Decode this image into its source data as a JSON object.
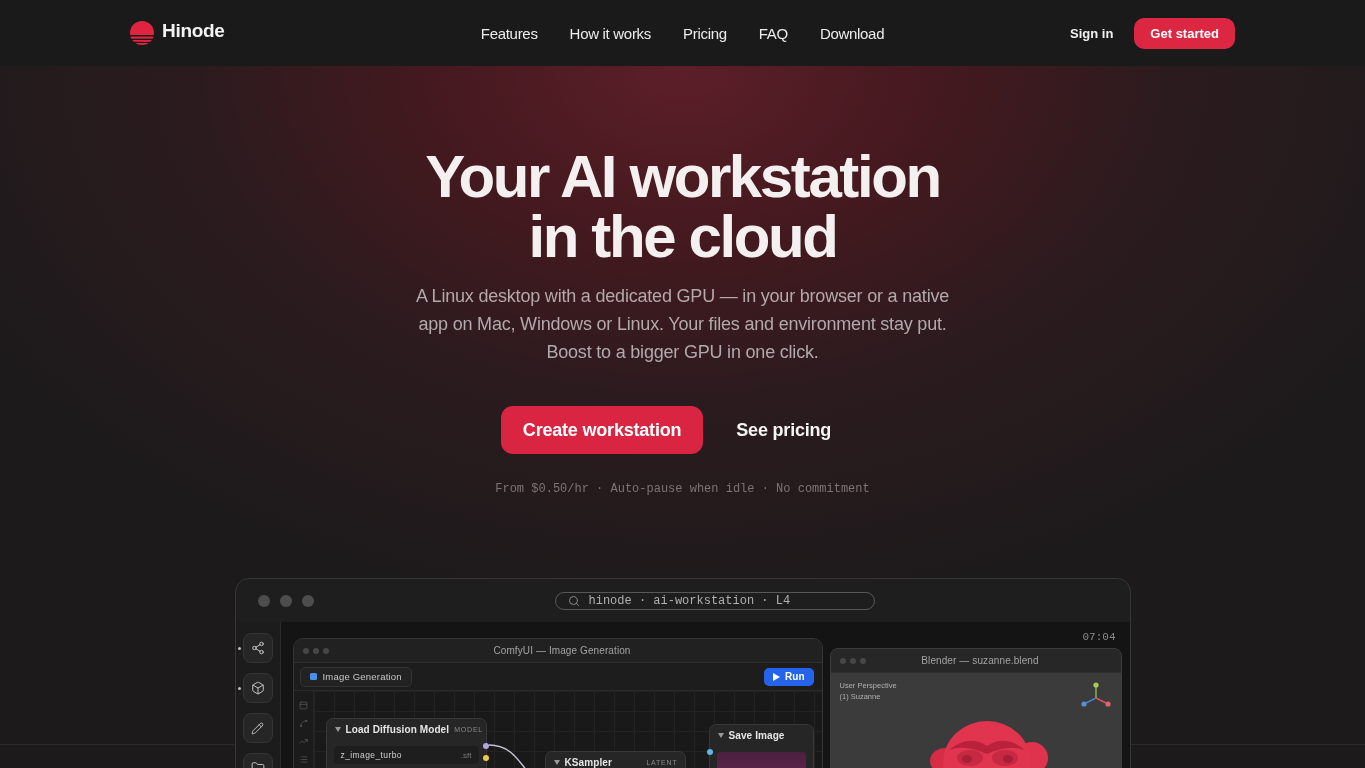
{
  "nav": {
    "brand": "Hinode",
    "links": [
      {
        "label": "Features"
      },
      {
        "label": "How it works"
      },
      {
        "label": "Pricing"
      },
      {
        "label": "FAQ"
      },
      {
        "label": "Download"
      }
    ],
    "sign_in": "Sign in",
    "cta": "Get started"
  },
  "hero": {
    "title_lines": [
      "Your AI workstation",
      "in the cloud"
    ],
    "subtitle_lines": [
      "A Linux desktop with a dedicated GPU — in your browser or a native",
      "app on Mac, Windows or Linux. Your files and environment stay put.",
      "Boost to a bigger GPU in one click."
    ],
    "primary_button": "Create workstation",
    "secondary_button": "See pricing",
    "note": "From $0.50/hr · Auto-pause when idle · No commitment"
  },
  "preview": {
    "address": "hinode · ai-workstation · L4",
    "clock": "07:04",
    "dock": [
      {
        "kind": "nodes",
        "running": true
      },
      {
        "kind": "cube",
        "running": true
      },
      {
        "kind": "pencil",
        "running": false
      },
      {
        "kind": "folder",
        "running": false
      }
    ],
    "comfy": {
      "title": "ComfyUI — Image Generation",
      "workflow": "Image Generation",
      "run": "Run",
      "nodes": [
        {
          "kind": "loader",
          "title": "Load Diffusion Model",
          "type": "MODEL",
          "field": "z_image_turbo",
          "field_ext": ".sft"
        },
        {
          "kind": "sampler",
          "title": "KSampler",
          "type": "LATENT"
        },
        {
          "kind": "output",
          "title": "Save Image"
        }
      ]
    },
    "blender": {
      "title": "Blender — suzanne.blend",
      "overlay": [
        "User Perspective",
        "(1) Suzanne"
      ]
    }
  }
}
